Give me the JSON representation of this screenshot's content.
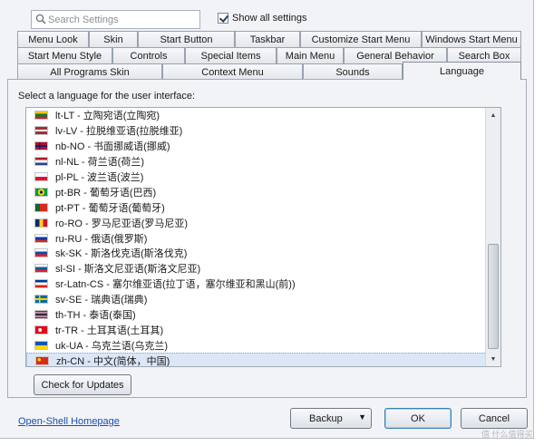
{
  "search": {
    "placeholder": "Search Settings"
  },
  "show_all": {
    "label": "Show all settings",
    "checked": true
  },
  "tabs": {
    "row1": [
      "Menu Look",
      "Skin",
      "Start Button",
      "Taskbar",
      "Customize Start Menu",
      "Windows Start Menu"
    ],
    "row2": [
      "Start Menu Style",
      "Controls",
      "Special Items",
      "Main Menu",
      "General Behavior",
      "Search Box"
    ],
    "row3": [
      "All Programs Skin",
      "Context Menu",
      "Sounds",
      "Language"
    ],
    "active": "Language"
  },
  "prompt": "Select a language for the user interface:",
  "languages": [
    {
      "label": "lt-LT - 立陶宛语(立陶宛)",
      "flag": "lt"
    },
    {
      "label": "lv-LV - 拉脱维亚语(拉脱维亚)",
      "flag": "lv"
    },
    {
      "label": "nb-NO - 书面挪威语(挪威)",
      "flag": "no"
    },
    {
      "label": "nl-NL - 荷兰语(荷兰)",
      "flag": "nl"
    },
    {
      "label": "pl-PL - 波兰语(波兰)",
      "flag": "pl"
    },
    {
      "label": "pt-BR - 葡萄牙语(巴西)",
      "flag": "br"
    },
    {
      "label": "pt-PT - 葡萄牙语(葡萄牙)",
      "flag": "pt"
    },
    {
      "label": "ro-RO - 罗马尼亚语(罗马尼亚)",
      "flag": "ro"
    },
    {
      "label": "ru-RU - 俄语(俄罗斯)",
      "flag": "ru"
    },
    {
      "label": "sk-SK - 斯洛伐克语(斯洛伐克)",
      "flag": "sk"
    },
    {
      "label": "sl-SI - 斯洛文尼亚语(斯洛文尼亚)",
      "flag": "si"
    },
    {
      "label": "sr-Latn-CS - 塞尔维亚语(拉丁语，塞尔维亚和黑山(前))",
      "flag": "cs"
    },
    {
      "label": "sv-SE - 瑞典语(瑞典)",
      "flag": "se"
    },
    {
      "label": "th-TH - 泰语(泰国)",
      "flag": "th"
    },
    {
      "label": "tr-TR - 土耳其语(土耳其)",
      "flag": "tr"
    },
    {
      "label": "uk-UA - 乌克兰语(乌克兰)",
      "flag": "ua"
    },
    {
      "label": "zh-CN - 中文(简体，中国)",
      "flag": "cn"
    }
  ],
  "selected_language": "zh-CN - 中文(简体，中国)",
  "buttons": {
    "check_updates": "Check for Updates",
    "backup": "Backup",
    "ok": "OK",
    "cancel": "Cancel"
  },
  "home_link": "Open-Shell Homepage",
  "watermark": "值 什么值得买",
  "colors": {
    "link": "#1c4fb0",
    "selection": "#dbe7f7",
    "default_button_border": "#3c7fb1"
  }
}
